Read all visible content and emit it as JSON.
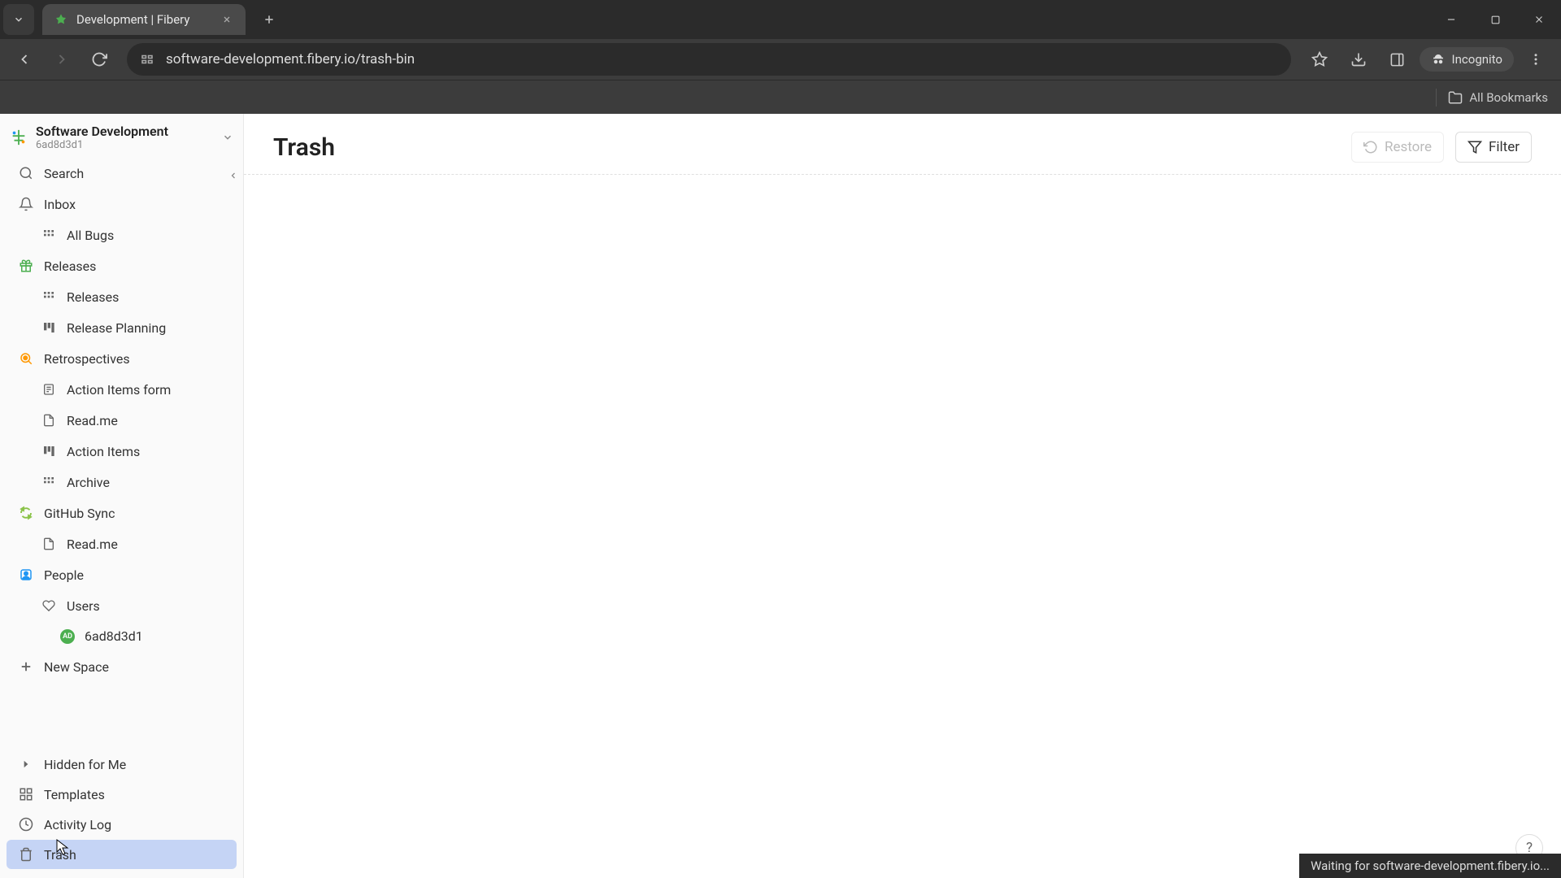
{
  "browser": {
    "tab_title": "Development | Fibery",
    "url": "software-development.fibery.io/trash-bin",
    "incognito_label": "Incognito",
    "all_bookmarks": "All Bookmarks"
  },
  "workspace": {
    "name": "Software Development",
    "id": "6ad8d3d1"
  },
  "sidebar": {
    "search": "Search",
    "inbox": "Inbox",
    "all_bugs": "All Bugs",
    "releases_section": "Releases",
    "releases": "Releases",
    "release_planning": "Release Planning",
    "retrospectives": "Retrospectives",
    "action_items_form": "Action Items form",
    "readme1": "Read.me",
    "action_items": "Action Items",
    "archive": "Archive",
    "github_sync": "GitHub Sync",
    "readme2": "Read.me",
    "people": "People",
    "users": "Users",
    "user_name": "6ad8d3d1",
    "user_initials": "AD",
    "new_space": "New Space",
    "hidden_for_me": "Hidden for Me",
    "templates": "Templates",
    "activity_log": "Activity Log",
    "trash": "Trash"
  },
  "main": {
    "title": "Trash",
    "restore": "Restore",
    "filter": "Filter"
  },
  "status": "Waiting for software-development.fibery.io...",
  "help": "?"
}
